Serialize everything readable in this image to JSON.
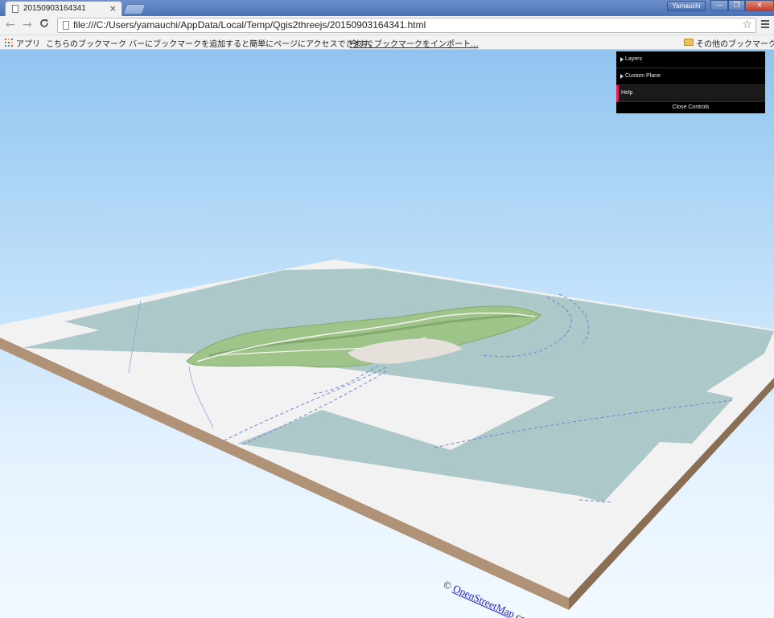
{
  "browser": {
    "tab_title": "20150903164341",
    "tab_close": "×",
    "user_name": "Yamauchi",
    "window_buttons": {
      "minimize": "—",
      "maximize": "❐",
      "close": "✕"
    },
    "nav": {
      "back": "←",
      "forward": "→",
      "reload": "C"
    },
    "url": "file:///C:/Users/yamauchi/AppData/Local/Temp/Qgis2threejs/20150903164341.html",
    "star": "☆"
  },
  "bookmarks": {
    "apps_label": "アプリ",
    "hint": "こちらのブックマーク バーにブックマークを追加すると簡単にページにアクセスできます。",
    "import_link": "今すぐブックマークをインポート...",
    "other_label": "その他のブックマーク",
    "apps_colors": [
      "#e8453c",
      "#f9bb2d",
      "#3b7de9",
      "#3dac5b",
      "#e8453c",
      "#f9bb2d",
      "#3b7de9",
      "#3dac5b",
      "#e8453c"
    ]
  },
  "controls": {
    "items": [
      {
        "label": "Layers"
      },
      {
        "label": "Custom Plane"
      },
      {
        "label": "Help"
      }
    ],
    "close_label": "Close Controls"
  },
  "map": {
    "attribution_prefix": "©",
    "attribution_link": "OpenStreetMap",
    "attribution_suffix": " contributors",
    "colors": {
      "water": "#adc8c8",
      "land": "#9fc48a",
      "land_dark": "#83aa6d",
      "urban": "#e6e0da",
      "road": "#f5f3ee",
      "no_data": "#f2f2f2",
      "base_side": "#b09377",
      "base_side_dark": "#8a6f55"
    }
  }
}
